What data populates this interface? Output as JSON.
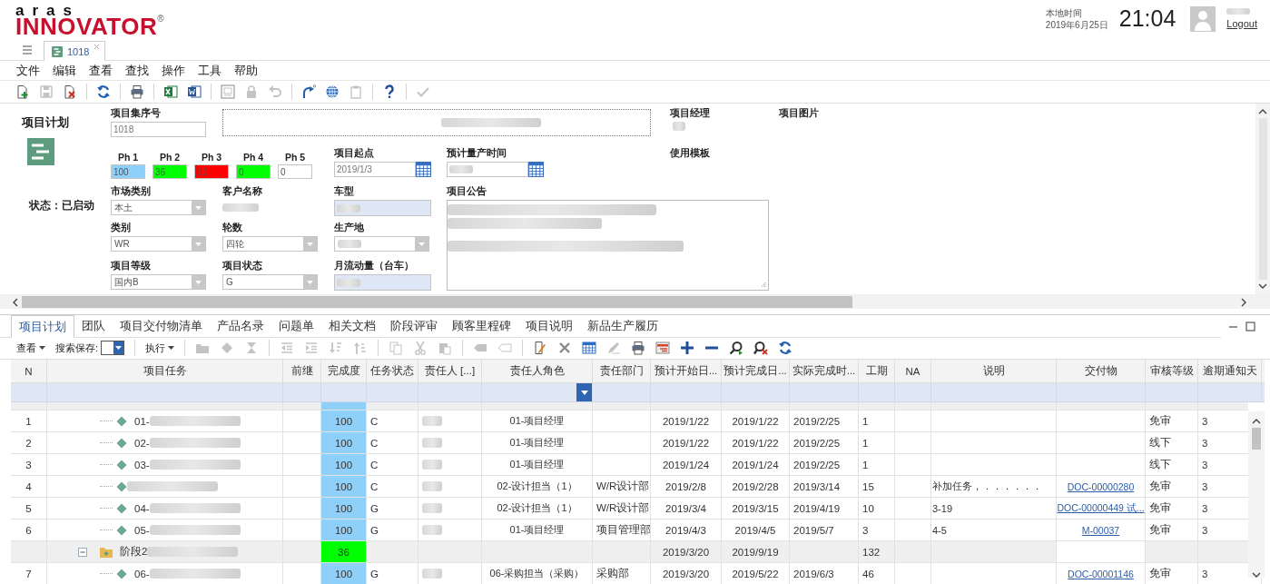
{
  "header": {
    "logo_top": "aras",
    "logo_main": "INNOVATOR",
    "logo_mark": "®",
    "clock_label": "本地时间",
    "date": "2019年6月25日",
    "time": "21:04",
    "logout": "Logout"
  },
  "doc_tabs": [
    {
      "label": "1018",
      "selected": true
    }
  ],
  "menu": [
    "文件",
    "编辑",
    "查看",
    "查找",
    "操作",
    "工具",
    "帮助"
  ],
  "toolbar": [
    {
      "kind": "new",
      "disabled": false
    },
    {
      "kind": "save",
      "disabled": true
    },
    {
      "kind": "delete",
      "disabled": false
    },
    {
      "kind": "sep"
    },
    {
      "kind": "refresh",
      "disabled": false
    },
    {
      "kind": "sep"
    },
    {
      "kind": "print",
      "disabled": false
    },
    {
      "kind": "sep"
    },
    {
      "kind": "excel",
      "disabled": false
    },
    {
      "kind": "word",
      "disabled": false
    },
    {
      "kind": "sep"
    },
    {
      "kind": "preview",
      "disabled": true
    },
    {
      "kind": "lock",
      "disabled": true
    },
    {
      "kind": "undo",
      "disabled": true
    },
    {
      "kind": "sep"
    },
    {
      "kind": "share",
      "disabled": false
    },
    {
      "kind": "globe",
      "disabled": false
    },
    {
      "kind": "clipboard",
      "disabled": true
    },
    {
      "kind": "sep"
    },
    {
      "kind": "help",
      "disabled": false
    },
    {
      "kind": "sep"
    },
    {
      "kind": "check",
      "disabled": true
    }
  ],
  "form": {
    "title": "项目计划",
    "status": "状态：已启动",
    "project_number": {
      "label": "项目集序号",
      "value": "1018"
    },
    "manager": {
      "label": "项目经理"
    },
    "picture": {
      "label": "项目图片"
    },
    "phases": [
      {
        "label": "Ph 1",
        "value": "100",
        "color": "#8fd0fa"
      },
      {
        "label": "Ph 2",
        "value": "36",
        "color": "#00ff00"
      },
      {
        "label": "Ph 3",
        "value": "10",
        "color": "#ff0000"
      },
      {
        "label": "Ph 4",
        "value": "0",
        "color": "#00ff00"
      },
      {
        "label": "Ph 5",
        "value": "0",
        "color": "#ffffff"
      }
    ],
    "start_date": {
      "label": "项目起点",
      "value": "2019/1/3"
    },
    "mass_production_date": {
      "label": "预计量产时间"
    },
    "template": {
      "label": "使用模板"
    },
    "market_type": {
      "label": "市场类别",
      "value": "本土"
    },
    "customer": {
      "label": "客户名称"
    },
    "vehicle": {
      "label": "车型"
    },
    "notice": {
      "label": "项目公告"
    },
    "category": {
      "label": "类别",
      "value": "WR"
    },
    "wheels": {
      "label": "轮数",
      "value": "四轮"
    },
    "origin": {
      "label": "生产地"
    },
    "grade": {
      "label": "项目等级",
      "value": "国内B"
    },
    "project_status": {
      "label": "项目状态",
      "value": "G"
    },
    "monthly_volume": {
      "label": "月流动量（台车）"
    }
  },
  "tabs": [
    {
      "label": "项目计划",
      "selected": true
    },
    {
      "label": "团队",
      "selected": false
    },
    {
      "label": "项目交付物清单",
      "selected": false
    },
    {
      "label": "产品名录",
      "selected": false
    },
    {
      "label": "问题单",
      "selected": false
    },
    {
      "label": "相关文档",
      "selected": false
    },
    {
      "label": "阶段评审",
      "selected": false
    },
    {
      "label": "顾客里程碑",
      "selected": false
    },
    {
      "label": "项目说明",
      "selected": false
    },
    {
      "label": "新品生产履历",
      "selected": false
    }
  ],
  "grid_toolbar": {
    "view": "查看",
    "search_save": "搜索保存:",
    "execute": "执行",
    "icons": [
      {
        "kind": "sep"
      },
      {
        "kind": "folder",
        "disabled": true
      },
      {
        "kind": "diamond",
        "disabled": true
      },
      {
        "kind": "hourglass",
        "disabled": true
      },
      {
        "kind": "sep"
      },
      {
        "kind": "outdent",
        "disabled": true
      },
      {
        "kind": "indent",
        "disabled": true
      },
      {
        "kind": "sort_down",
        "disabled": true
      },
      {
        "kind": "sort_up",
        "disabled": true
      },
      {
        "kind": "sep"
      },
      {
        "kind": "copy",
        "disabled": true
      },
      {
        "kind": "cut",
        "disabled": true
      },
      {
        "kind": "paste",
        "disabled": true
      },
      {
        "kind": "sep"
      },
      {
        "kind": "tag",
        "disabled": true
      },
      {
        "kind": "tag_outline",
        "disabled": true
      },
      {
        "kind": "sep"
      },
      {
        "kind": "edit",
        "disabled": false
      },
      {
        "kind": "remove",
        "disabled": false
      },
      {
        "kind": "calendar",
        "disabled": false
      },
      {
        "kind": "pen",
        "disabled": true
      },
      {
        "kind": "print",
        "disabled": false
      },
      {
        "kind": "gantt",
        "disabled": false
      },
      {
        "kind": "plus",
        "disabled": false
      },
      {
        "kind": "minus",
        "disabled": false
      },
      {
        "kind": "find",
        "disabled": false
      },
      {
        "kind": "find_clear",
        "disabled": false
      },
      {
        "kind": "refresh",
        "disabled": false
      }
    ]
  },
  "table": {
    "columns": [
      "N",
      "项目任务",
      "前继",
      "完成度",
      "任务状态",
      "责任人 [...]",
      "责任人角色",
      "责任部门",
      "预计开始日...",
      "预计完成日...",
      "实际完成时...",
      "工期",
      "NA",
      "说明",
      "交付物",
      "审核等级",
      "逾期通知天"
    ],
    "rows": [
      {
        "kind": "phase",
        "color": "#8fd0fa",
        "children": [
          {
            "kind": "task",
            "n": "1",
            "name": "01-",
            "completion": "100",
            "color": "#8fd0fa",
            "status": "C",
            "role": "01-项目经理",
            "start": "2019/1/22",
            "finish": "2019/1/22",
            "actual": "2019/2/25",
            "duration": "1",
            "review": "免审",
            "overdue": "3"
          },
          {
            "kind": "task",
            "n": "2",
            "name": "02-",
            "completion": "100",
            "color": "#8fd0fa",
            "status": "C",
            "role": "01-项目经理",
            "start": "2019/1/22",
            "finish": "2019/1/22",
            "actual": "2019/2/25",
            "duration": "1",
            "review": "线下",
            "overdue": "3"
          },
          {
            "kind": "task",
            "n": "3",
            "name": "03-",
            "completion": "100",
            "color": "#8fd0fa",
            "status": "C",
            "role": "01-项目经理",
            "start": "2019/1/24",
            "finish": "2019/1/24",
            "actual": "2019/2/25",
            "duration": "1",
            "review": "线下",
            "overdue": "3"
          },
          {
            "kind": "task",
            "n": "4",
            "completion": "100",
            "color": "#8fd0fa",
            "status": "C",
            "role": "02-设计担当（1）",
            "dept": "W/R设计部",
            "start": "2019/2/8",
            "finish": "2019/2/28",
            "actual": "2019/3/14",
            "duration": "15",
            "note": "补加任务，．．．．．．",
            "deliverable": "DOC-00000280",
            "review": "免审",
            "overdue": "3"
          },
          {
            "kind": "task",
            "n": "5",
            "name": "04-",
            "completion": "100",
            "color": "#8fd0fa",
            "status": "G",
            "role": "02-设计担当（1）",
            "dept": "W/R设计部",
            "start": "2019/3/4",
            "finish": "2019/3/15",
            "actual": "2019/4/19",
            "duration": "10",
            "note": "3-19",
            "deliverable": "DOC-00000449 试...",
            "review": "免审",
            "overdue": "3"
          },
          {
            "kind": "task",
            "n": "6",
            "name": "05-",
            "completion": "100",
            "color": "#8fd0fa",
            "status": "G",
            "role": "01-项目经理",
            "dept": "项目管理部",
            "start": "2019/4/3",
            "finish": "2019/4/5",
            "actual": "2019/5/7",
            "duration": "3",
            "note": "4-5",
            "deliverable": "M-00037",
            "review": "免审",
            "overdue": "3"
          }
        ]
      },
      {
        "kind": "phase",
        "name": "阶段2",
        "completion": "36",
        "color": "#00ff00",
        "start": "2019/3/20",
        "finish": "2019/9/19",
        "duration": "132",
        "children": [
          {
            "kind": "task",
            "n": "7",
            "name": "06-",
            "completion": "100",
            "color": "#8fd0fa",
            "status": "G",
            "role": "06-采购担当（采购）",
            "dept": "采购部",
            "start": "2019/3/20",
            "finish": "2019/5/22",
            "actual": "2019/6/3",
            "duration": "46",
            "deliverable": "DOC-00001146",
            "review": "免审",
            "overdue": "3"
          }
        ]
      }
    ]
  }
}
